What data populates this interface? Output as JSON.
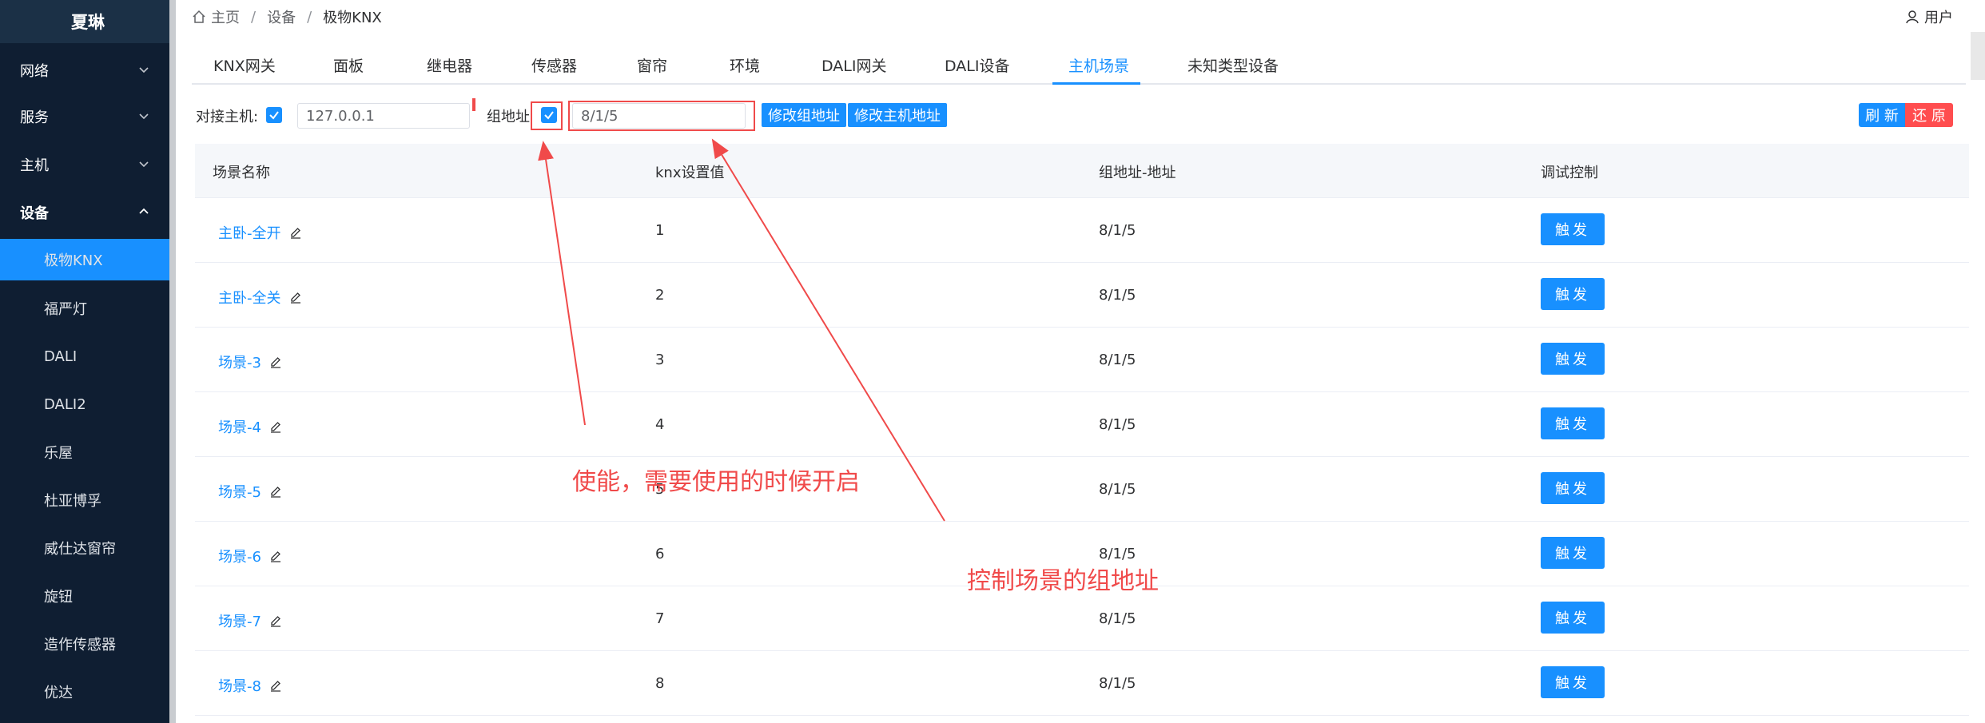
{
  "sidebar": {
    "brand": "夏琳",
    "items": [
      {
        "label": "网络"
      },
      {
        "label": "服务"
      },
      {
        "label": "主机"
      },
      {
        "label": "设备"
      },
      {
        "label": "极物KNX"
      },
      {
        "label": "福严灯"
      },
      {
        "label": "DALI"
      },
      {
        "label": "DALI2"
      },
      {
        "label": "乐屋"
      },
      {
        "label": "杜亚博孚"
      },
      {
        "label": "威仕达窗帘"
      },
      {
        "label": "旋钮"
      },
      {
        "label": "造作传感器"
      },
      {
        "label": "优达"
      }
    ]
  },
  "breadcrumb": {
    "home": "主页",
    "sep": "/",
    "level1": "设备",
    "level2": "极物KNX"
  },
  "user": {
    "label": "用户"
  },
  "tabs": [
    "KNX网关",
    "面板",
    "继电器",
    "传感器",
    "窗帘",
    "环境",
    "DALI网关",
    "DALI设备",
    "主机场景",
    "未知类型设备"
  ],
  "toolbar": {
    "host_label": "对接主机:",
    "host_value": "127.0.0.1",
    "group_label": "组地址",
    "group_value": "8/1/5",
    "modify_group_btn": "修改组地址",
    "modify_host_btn": "修改主机地址",
    "refresh_btn": "刷 新",
    "restore_btn": "还 原"
  },
  "table": {
    "headers": [
      "场景名称",
      "knx设置值",
      "组地址-地址",
      "调试控制"
    ],
    "trigger_label": "触发",
    "rows": [
      {
        "name": "主卧-全开",
        "value": "1",
        "addr": "8/1/5"
      },
      {
        "name": "主卧-全关",
        "value": "2",
        "addr": "8/1/5"
      },
      {
        "name": "场景-3",
        "value": "3",
        "addr": "8/1/5"
      },
      {
        "name": "场景-4",
        "value": "4",
        "addr": "8/1/5"
      },
      {
        "name": "场景-5",
        "value": "5",
        "addr": "8/1/5"
      },
      {
        "name": "场景-6",
        "value": "6",
        "addr": "8/1/5"
      },
      {
        "name": "场景-7",
        "value": "7",
        "addr": "8/1/5"
      },
      {
        "name": "场景-8",
        "value": "8",
        "addr": "8/1/5"
      }
    ]
  },
  "annotations": {
    "enable_note": "使能，需要使用的时候开启",
    "group_note": "控制场景的组地址"
  },
  "colors": {
    "primary": "#1890ff",
    "danger": "#ff4d4f",
    "annotation": "#f04a4a",
    "sidebar": "#0f1e32"
  }
}
